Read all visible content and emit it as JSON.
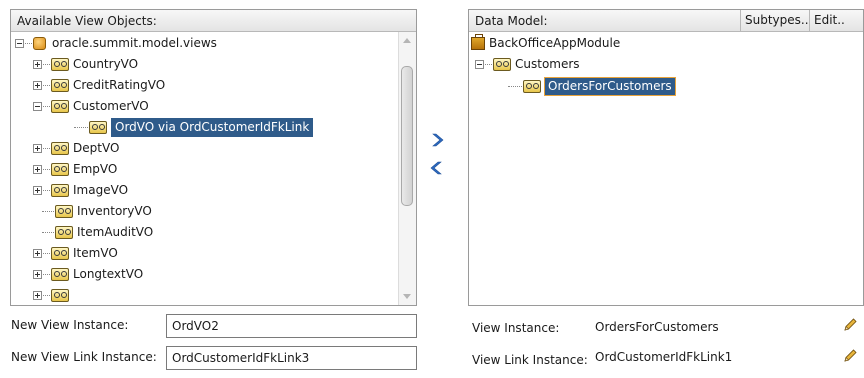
{
  "available": {
    "header": "Available View Objects:",
    "items": [
      {
        "label": "oracle.summit.model.views",
        "kind": "package",
        "expander": "minus"
      },
      {
        "label": "CountryVO",
        "kind": "vo",
        "expander": "plus"
      },
      {
        "label": "CreditRatingVO",
        "kind": "vo",
        "expander": "plus"
      },
      {
        "label": "CustomerVO",
        "kind": "vo",
        "expander": "minus"
      },
      {
        "label": "OrdVO via OrdCustomerIdFkLink",
        "kind": "vo",
        "expander": "leaf",
        "selected": true
      },
      {
        "label": "DeptVO",
        "kind": "vo",
        "expander": "plus"
      },
      {
        "label": "EmpVO",
        "kind": "vo",
        "expander": "plus"
      },
      {
        "label": "ImageVO",
        "kind": "vo",
        "expander": "plus"
      },
      {
        "label": "InventoryVO",
        "kind": "vo",
        "expander": "none"
      },
      {
        "label": "ItemAuditVO",
        "kind": "vo",
        "expander": "none"
      },
      {
        "label": "ItemVO",
        "kind": "vo",
        "expander": "plus"
      },
      {
        "label": "LongtextVO",
        "kind": "vo",
        "expander": "plus"
      }
    ]
  },
  "shuttle": {
    "add_icon": "chevron-right-icon",
    "remove_icon": "chevron-left-icon",
    "color": "#2e6ac0"
  },
  "form": {
    "new_view_instance_label": "New View Instance:",
    "new_view_instance_value": "OrdVO2",
    "new_view_link_instance_label": "New View Link Instance:",
    "new_view_link_instance_value": "OrdCustomerIdFkLink3"
  },
  "data_model": {
    "header": "Data Model:",
    "subtypes_label": "Subtypes...",
    "edit_label": "Edit..",
    "items": [
      {
        "label": "BackOfficeAppModule",
        "kind": "appmodule"
      },
      {
        "label": "Customers",
        "kind": "vo",
        "expander": "minus"
      },
      {
        "label": "OrdersForCustomers",
        "kind": "vo",
        "selected": true
      }
    ]
  },
  "details": {
    "view_instance_label": "View Instance:",
    "view_instance_value": "OrdersForCustomers",
    "view_link_instance_label": "View Link Instance:",
    "view_link_instance_value": "OrdCustomerIdFkLink1",
    "edit_icon": "pencil-icon"
  },
  "colors": {
    "selection": "#2f5b8a",
    "selection_outline": "#e8a33b"
  }
}
